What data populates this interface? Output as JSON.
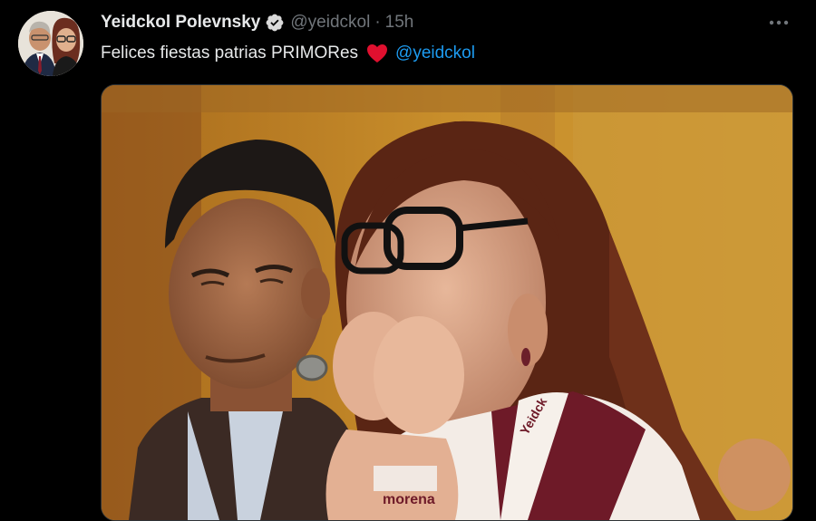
{
  "tweet": {
    "display_name": "Yeidckol Polevnsky",
    "handle": "@yeidckol",
    "separator": "·",
    "time": "15h",
    "text": "Felices fiestas patrias PRIMORes",
    "mention": "@yeidckol",
    "verified": true,
    "more_icon": "more-horizontal-icon",
    "heart_icon": "red-heart-emoji"
  },
  "media": {
    "vest_text_left": "morena",
    "vest_text_right": "Yeidck"
  },
  "colors": {
    "background": "#000000",
    "text": "#e7e9ea",
    "muted": "#71767b",
    "link": "#1d9bf0",
    "heart": "#e0102f",
    "verified_badge": "#d9d9d9"
  }
}
